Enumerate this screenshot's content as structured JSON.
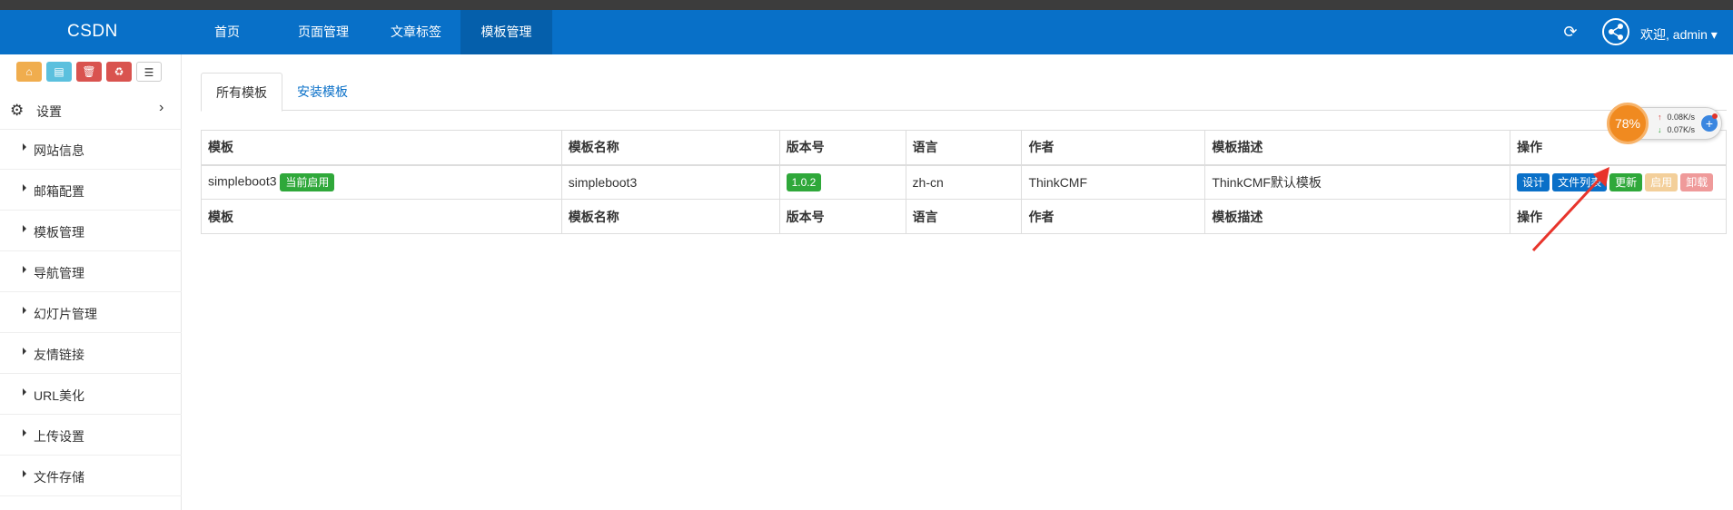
{
  "navbar": {
    "brand": "CSDN",
    "items": [
      {
        "label": "首页"
      },
      {
        "label": "页面管理"
      },
      {
        "label": "文章标签"
      },
      {
        "label": "模板管理"
      }
    ],
    "active_item": "模板管理",
    "refresh_icon": "refresh-icon",
    "welcome": "欢迎, admin ▾",
    "color": "#0870c8"
  },
  "sidebar": {
    "shortcut_icons": [
      "home-icon",
      "file-icon",
      "trash-icon",
      "recycle-icon",
      "list-icon"
    ],
    "shortcut_colors": [
      "#f0ad4e",
      "#5bc0de",
      "#d9534f",
      "#d9534f",
      "#ffffff"
    ],
    "section": "设置",
    "items": [
      {
        "label": "网站信息"
      },
      {
        "label": "邮箱配置"
      },
      {
        "label": "模板管理"
      },
      {
        "label": "导航管理"
      },
      {
        "label": "幻灯片管理"
      },
      {
        "label": "友情链接"
      },
      {
        "label": "URL美化"
      },
      {
        "label": "上传设置"
      },
      {
        "label": "文件存储"
      }
    ]
  },
  "tabs": [
    {
      "label": "所有模板",
      "active": true
    },
    {
      "label": "安装模板",
      "active": false
    }
  ],
  "table": {
    "headers": [
      "模板",
      "模板名称",
      "版本号",
      "语言",
      "作者",
      "模板描述",
      "操作"
    ],
    "rows": [
      {
        "template": "simpleboot3",
        "status_badge": "当前启用",
        "name": "simpleboot3",
        "version": "1.0.2",
        "language": "zh-cn",
        "author": "ThinkCMF",
        "description": "ThinkCMF默认模板",
        "actions": [
          {
            "label": "设计",
            "color": "#0a70c8"
          },
          {
            "label": "文件列表",
            "color": "#0a70c8"
          },
          {
            "label": "更新",
            "color": "#2fa83a"
          },
          {
            "label": "启用",
            "color": "#f3cf9a"
          },
          {
            "label": "卸载",
            "color": "#ef9a9a"
          }
        ]
      }
    ]
  },
  "speed_widget": {
    "percent": "78%",
    "upload": "0.08K/s",
    "download": "0.07K/s"
  }
}
